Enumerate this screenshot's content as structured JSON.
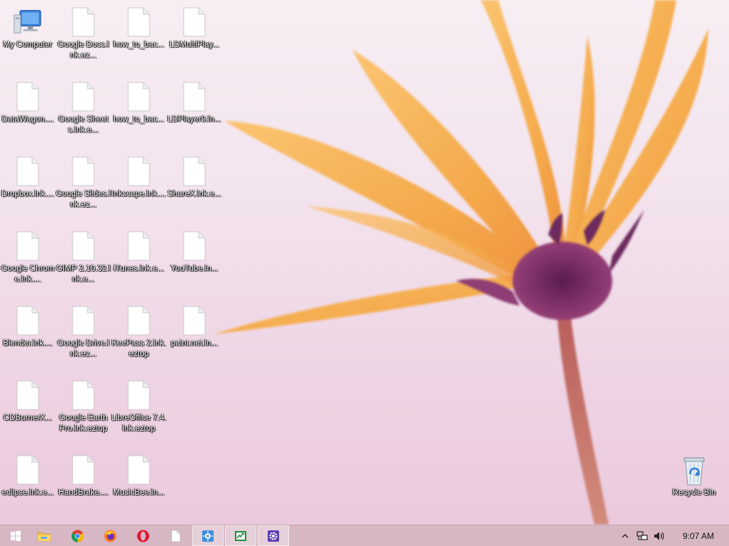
{
  "desktop": {
    "icons": [
      {
        "label": "My Computer",
        "kind": "computer-icon"
      },
      {
        "label": "DataWagon....",
        "kind": "file-icon"
      },
      {
        "label": "Dropbox.lnk....",
        "kind": "file-icon"
      },
      {
        "label": "Google Chrome.lnk....",
        "kind": "file-icon"
      },
      {
        "label": "Blender.lnk....",
        "kind": "file-icon"
      },
      {
        "label": "CDBurnerX...",
        "kind": "file-icon"
      },
      {
        "label": "eclipse.lnk.e...",
        "kind": "file-icon"
      },
      {
        "label": "Google Docs.lnk.ez...",
        "kind": "file-icon"
      },
      {
        "label": "Google Sheets.lnk.e...",
        "kind": "file-icon"
      },
      {
        "label": "Google Slides.lnk.ez...",
        "kind": "file-icon"
      },
      {
        "label": "GIMP 2.10.32.lnk.e...",
        "kind": "file-icon"
      },
      {
        "label": "Google Drive.lnk.ez...",
        "kind": "file-icon"
      },
      {
        "label": "Google Earth Pro.lnk.eztop",
        "kind": "file-icon"
      },
      {
        "label": "HandBrake....",
        "kind": "file-icon"
      },
      {
        "label": "how_to_bac...",
        "kind": "file-icon"
      },
      {
        "label": "how_to_bac...",
        "kind": "file-icon"
      },
      {
        "label": "Inkscape.lnk....",
        "kind": "file-icon"
      },
      {
        "label": "iTunes.lnk.e...",
        "kind": "file-icon"
      },
      {
        "label": "KeePass 2.lnk.eztop",
        "kind": "file-icon"
      },
      {
        "label": "LibreOffice 7.4.lnk.eztop",
        "kind": "file-icon"
      },
      {
        "label": "MusicBee.ln...",
        "kind": "file-icon"
      },
      {
        "label": "LDMultiPlay...",
        "kind": "file-icon"
      },
      {
        "label": "LDPlayer9.ln...",
        "kind": "file-icon"
      },
      {
        "label": "ShareX.lnk.e...",
        "kind": "file-icon"
      },
      {
        "label": "YouTube.ln...",
        "kind": "file-icon"
      },
      {
        "label": "paint.net.ln...",
        "kind": "file-icon"
      }
    ],
    "recycle_bin": {
      "label": "Recycle Bin",
      "kind": "recycle-bin-icon"
    }
  },
  "taskbar": {
    "items": [
      {
        "name": "start-button",
        "icon": "windows-logo-icon",
        "active": false
      },
      {
        "name": "file-explorer-button",
        "icon": "folder-icon",
        "active": false
      },
      {
        "name": "chrome-button",
        "icon": "chrome-icon",
        "active": false
      },
      {
        "name": "firefox-button",
        "icon": "firefox-icon",
        "active": false
      },
      {
        "name": "opera-button",
        "icon": "opera-icon",
        "active": false
      },
      {
        "name": "blank-document-button",
        "icon": "document-icon",
        "active": false
      },
      {
        "name": "control-panel-button",
        "icon": "control-panel-icon",
        "active": true
      },
      {
        "name": "task-manager-button",
        "icon": "task-manager-icon",
        "active": true
      },
      {
        "name": "settings-app-button",
        "icon": "gear-icon",
        "active": true
      }
    ],
    "tray": {
      "clock": "9:07 AM",
      "icons": [
        "chevron-up-icon",
        "network-icon",
        "speaker-icon"
      ]
    }
  },
  "colors": {
    "taskbar": "#d8b7c5",
    "petal": "#f5b04a",
    "flower_center": "#7a2a62"
  }
}
